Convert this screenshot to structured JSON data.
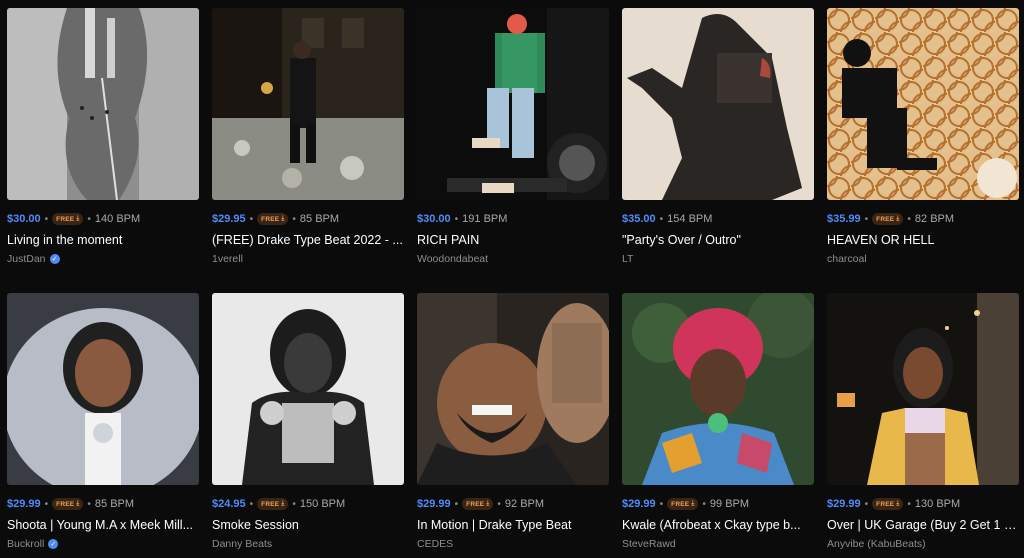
{
  "colors": {
    "price": "#4f8cf7",
    "free_bg": "#3a2413",
    "free_text": "#f0a35a",
    "background": "#0b0b0b"
  },
  "free_label": "FREE",
  "free_icon": "download-icon",
  "verified_icon": "verified-badge-icon",
  "beats": [
    {
      "price": "$30.00",
      "bpm": "140 BPM",
      "title": "Living in the moment",
      "artist": "JustDan",
      "verified": true
    },
    {
      "price": "$29.95",
      "bpm": "85 BPM",
      "title": "(FREE) Drake Type Beat 2022 - ...",
      "artist": "1verell",
      "verified": false
    },
    {
      "price": "$30.00",
      "bpm": "191 BPM",
      "title": "RICH PAIN",
      "artist": "Woodondabeat",
      "verified": false
    },
    {
      "price": "$35.00",
      "bpm": "154 BPM",
      "title": "\"Party's Over / Outro\"",
      "artist": "LT",
      "verified": false
    },
    {
      "price": "$35.99",
      "bpm": "82 BPM",
      "title": "HEAVEN OR HELL",
      "artist": "charcoal",
      "verified": false
    },
    {
      "price": "$29.99",
      "bpm": "85 BPM",
      "title": "Shoota | Young M.A x Meek Mill...",
      "artist": "Buckroll",
      "verified": true
    },
    {
      "price": "$24.95",
      "bpm": "150 BPM",
      "title": "Smoke Session",
      "artist": "Danny Beats",
      "verified": false
    },
    {
      "price": "$29.99",
      "bpm": "92 BPM",
      "title": "In Motion | Drake Type Beat",
      "artist": "CEDES",
      "verified": false
    },
    {
      "price": "$29.99",
      "bpm": "99 BPM",
      "title": "Kwale (Afrobeat x Ckay type b...",
      "artist": "SteveRawd",
      "verified": false
    },
    {
      "price": "$29.99",
      "bpm": "130 BPM",
      "title": "Over | UK Garage (Buy 2 Get 1 F...",
      "artist": "Anyvibe (KabuBeats)",
      "verified": false
    }
  ]
}
